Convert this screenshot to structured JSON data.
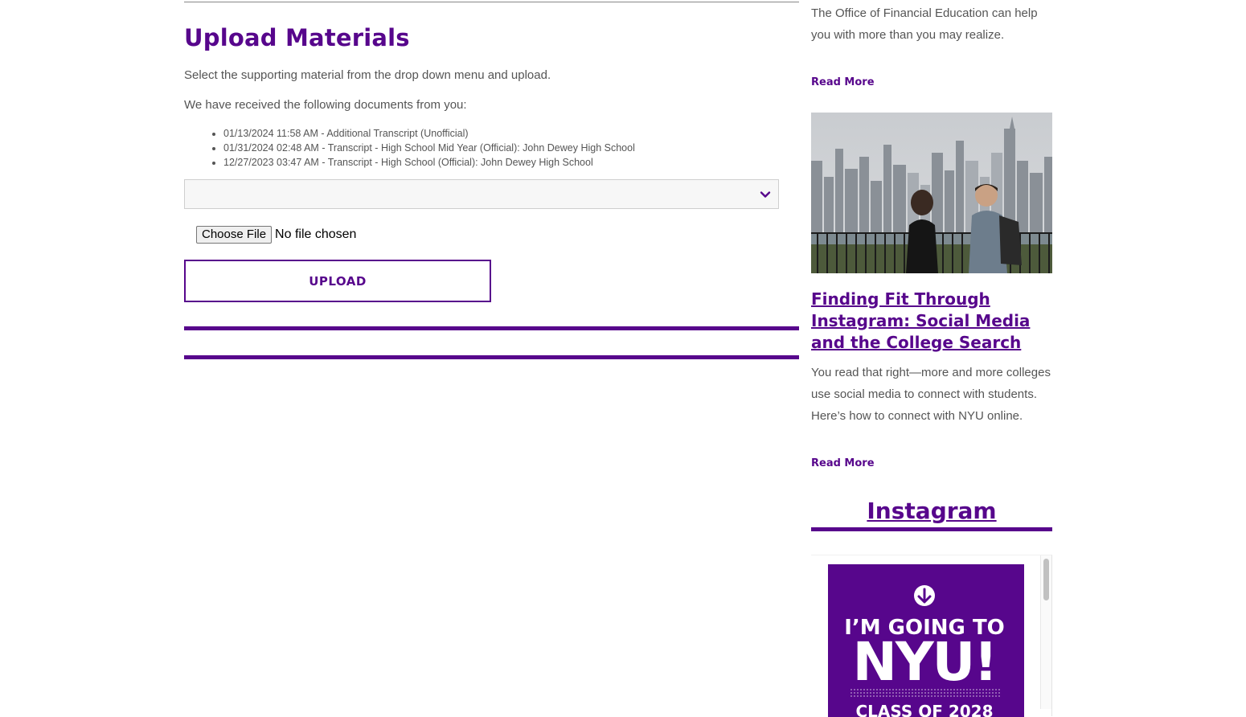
{
  "main": {
    "title": "Upload Materials",
    "instructions": "Select the supporting material from the drop down menu and upload.",
    "received_label": "We have received the following documents from you:",
    "documents": [
      "01/13/2024 11:58 AM - Additional Transcript (Unofficial)",
      "01/31/2024 02:48 AM - Transcript - High School Mid Year (Official): John Dewey High School",
      "12/27/2023 03:47 AM - Transcript - High School (Official): John Dewey High School"
    ],
    "select": {
      "value": "",
      "icon": "chevron-down-icon"
    },
    "file_input": {
      "button_label": "Choose File",
      "status": "No file chosen"
    },
    "upload_label": "UPLOAD"
  },
  "sidebar": {
    "financial_text": "The Office of Financial Education can help you with more than you may realize.",
    "read_more_1": "Read More",
    "article": {
      "title": "Finding Fit Through Instagram: Social Media and the College Search",
      "text": "You read that right—more and more colleges use social media to connect with students. Here’s how to connect with NYU online.",
      "read_more": "Read More"
    },
    "instagram": {
      "heading": "Instagram",
      "post_line1": "I’M GOING TO",
      "post_line2": "NYU!",
      "post_line3": "CLASS OF 2028"
    }
  },
  "colors": {
    "brand": "#57068c",
    "text": "#555555"
  }
}
